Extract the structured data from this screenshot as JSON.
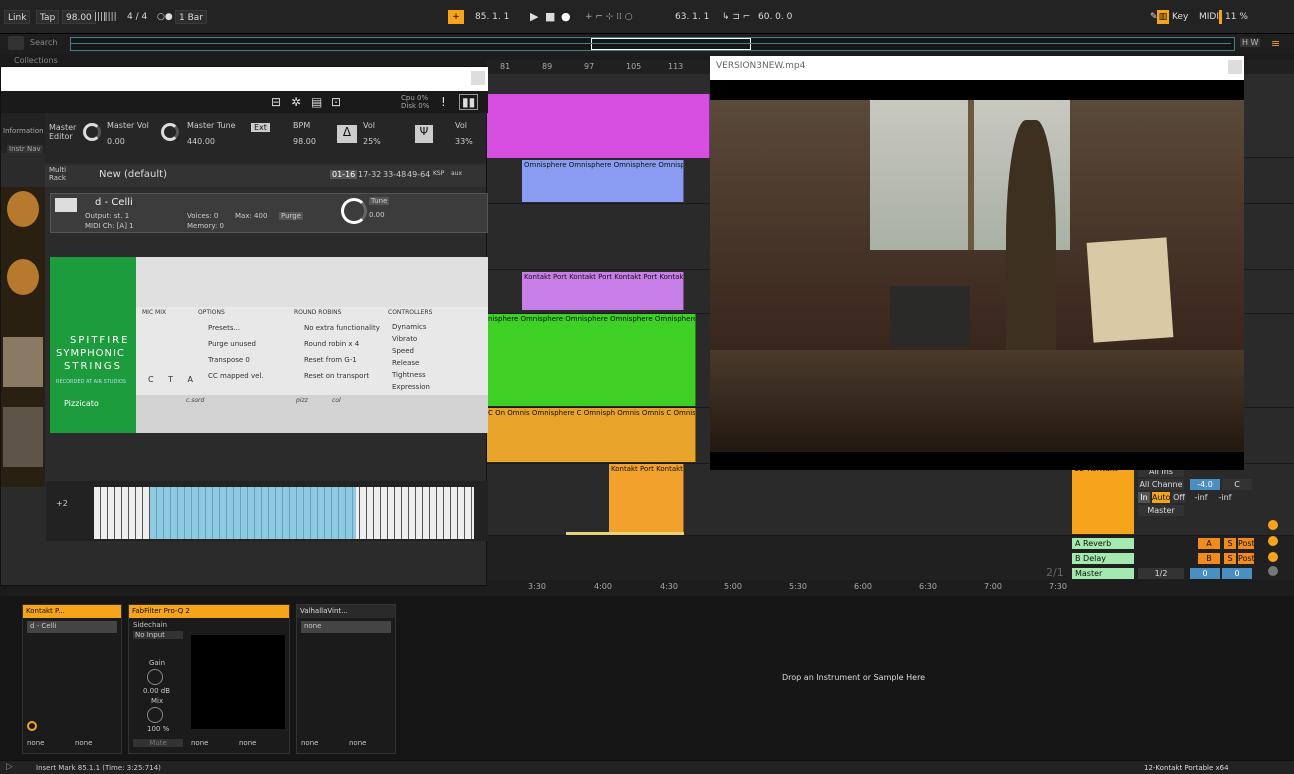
{
  "transport": {
    "link": "Link",
    "tap": "Tap",
    "bpm": "98.00",
    "sig": "4 / 4",
    "quant": "1 Bar",
    "position": "85. 1. 1",
    "loop_start": "63. 1. 1",
    "loop_len": "60. 0. 0",
    "key": "Key",
    "midi": "MIDI",
    "cpu": "11 %"
  },
  "browser": {
    "search": "Search",
    "collections": "Collections"
  },
  "ruler": {
    "bars": [
      "81",
      "89",
      "97",
      "105",
      "113"
    ],
    "times": [
      "3:30",
      "4:00",
      "4:30",
      "5:00",
      "5:30",
      "6:00",
      "6:30",
      "7:00",
      "7:30"
    ],
    "mark": "2/1"
  },
  "clips": {
    "omni": "Omnisphere",
    "kontakt": "Kontakt Port",
    "kontakt_short": "Kontakt Port Kontakt Port Kontakt P",
    "omni_row": "Omnisphere Omnisphere Omnisphere Omnisphe",
    "omni_row2": "nisphere Omnisphere Omnisphere Omnisphere Omnisphere",
    "omni_row3": "C On Omnis Omnisphere C Omnisph Omnis Omnis C Omnispher",
    "kontakt_row": "Kontakt Port Kontakt Port Kontakt Port Kontakt P",
    "kontakt_low": "Kontakt Port Kontakt P"
  },
  "mixer": {
    "track_name": "12-Kontakt",
    "all_ins": "All Ins",
    "all_channels": "All Channe",
    "vol": "-4.0",
    "pan": "C",
    "in": "In",
    "auto": "Auto",
    "off": "Off",
    "inf1": "-inf",
    "inf2": "-inf",
    "master_out": "Master",
    "returns": [
      {
        "name": "A Reverb",
        "letter": "A"
      },
      {
        "name": "B Delay",
        "letter": "B"
      }
    ],
    "master": "Master",
    "master_sig": "1/2",
    "zero1": "0",
    "zero2": "0",
    "post": "Post",
    "s": "S"
  },
  "kontakt": {
    "master_editor": "Master Editor",
    "master_vol_label": "Master Vol",
    "master_vol": "0.00",
    "master_tune_label": "Master Tune",
    "master_tune": "440.00",
    "ext": "Ext",
    "bpm_label": "BPM",
    "bpm": "98.00",
    "vol_label": "Vol",
    "vol": "25%",
    "vol2_label": "Vol",
    "vol2": "33%",
    "multi_rack": "Multi Rack",
    "preset": "New (default)",
    "ranges": [
      "01-16",
      "17-32",
      "33-48",
      "49-64",
      "KSP",
      "aux"
    ],
    "cpu": "Cpu 0%",
    "disk": "Disk 0%",
    "side_left": "Information",
    "side_left2": "Instr Nav",
    "inst_name": "d - Celli",
    "output": "Output: st. 1",
    "midi_ch": "MIDI Ch: [A] 1",
    "voices": "Voices: 0",
    "max": "Max: 400",
    "memory": "Memory: 0",
    "purge": "Purge",
    "tune": "Tune",
    "tune_val": "0.00",
    "brand1": "SPITFIRE",
    "brand2": "SYMPHONIC",
    "brand3": "STRINGS",
    "recorded": "RECORDED AT AIR STUDIOS",
    "articulation": "Pizzicato",
    "mic_mix": "MIC MIX",
    "options": "OPTIONS",
    "round_robins": "ROUND ROBINS",
    "controllers": "CONTROLLERS",
    "mics": "C T A",
    "opts": [
      "Presets...",
      "Purge unused",
      "Transpose  0",
      "CC mapped vel."
    ],
    "rr": [
      "No extra functionality",
      "Round robin  x 4",
      "Reset from   G-1",
      "Reset on transport"
    ],
    "ctrls": [
      "Dynamics",
      "Vibrato",
      "Speed",
      "Release",
      "Tightness",
      "Expression"
    ],
    "art_labels": [
      "c.sord",
      "pizz",
      "col"
    ],
    "octave": "+2"
  },
  "video": {
    "title": "VERSION3NEW.mp4"
  },
  "devices": {
    "d1": "Kontakt P...",
    "d1_sub": "d - Celli",
    "d2": "FabFilter Pro-Q 2",
    "d2_sidechain": "Sidechain",
    "d2_input": "No Input",
    "gain": "Gain",
    "gain_val": "0.00 dB",
    "mix": "Mix",
    "mix_val": "100 %",
    "mute": "Mute",
    "d3": "ValhallaVint...",
    "d3_sub": "none",
    "none": "none",
    "drop": "Drop an Instrument or Sample Here"
  },
  "status": {
    "left": "Insert Mark 85.1.1 (Time: 3:25:714)",
    "right": "12-Kontakt Portable x64"
  }
}
